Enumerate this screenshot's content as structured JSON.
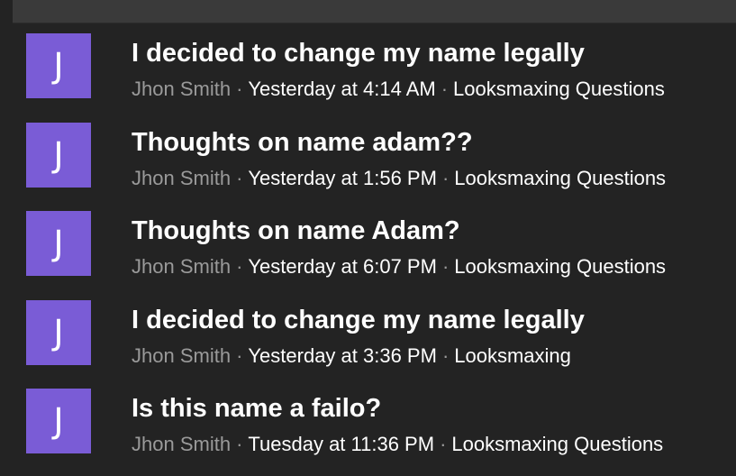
{
  "threads": [
    {
      "avatar_letter": "J",
      "title": "I decided to change my name legally",
      "author": "Jhon Smith",
      "date": "Yesterday at 4:14 AM",
      "forum": "Looksmaxing Questions"
    },
    {
      "avatar_letter": "J",
      "title": "Thoughts on name adam??",
      "author": "Jhon Smith",
      "date": "Yesterday at 1:56 PM",
      "forum": "Looksmaxing Questions"
    },
    {
      "avatar_letter": "J",
      "title": "Thoughts on name Adam?",
      "author": "Jhon Smith",
      "date": "Yesterday at 6:07 PM",
      "forum": "Looksmaxing Questions"
    },
    {
      "avatar_letter": "J",
      "title": "I decided to change my name legally",
      "author": "Jhon Smith",
      "date": "Yesterday at 3:36 PM",
      "forum": "Looksmaxing"
    },
    {
      "avatar_letter": "J",
      "title": "Is this name a failo?",
      "author": "Jhon Smith",
      "date": "Tuesday at 11:36 PM",
      "forum": "Looksmaxing Questions"
    }
  ],
  "separator": "·",
  "colors": {
    "background": "#232323",
    "avatar": "#7a5cd6",
    "title": "#ffffff",
    "author": "#9a9a9a"
  }
}
